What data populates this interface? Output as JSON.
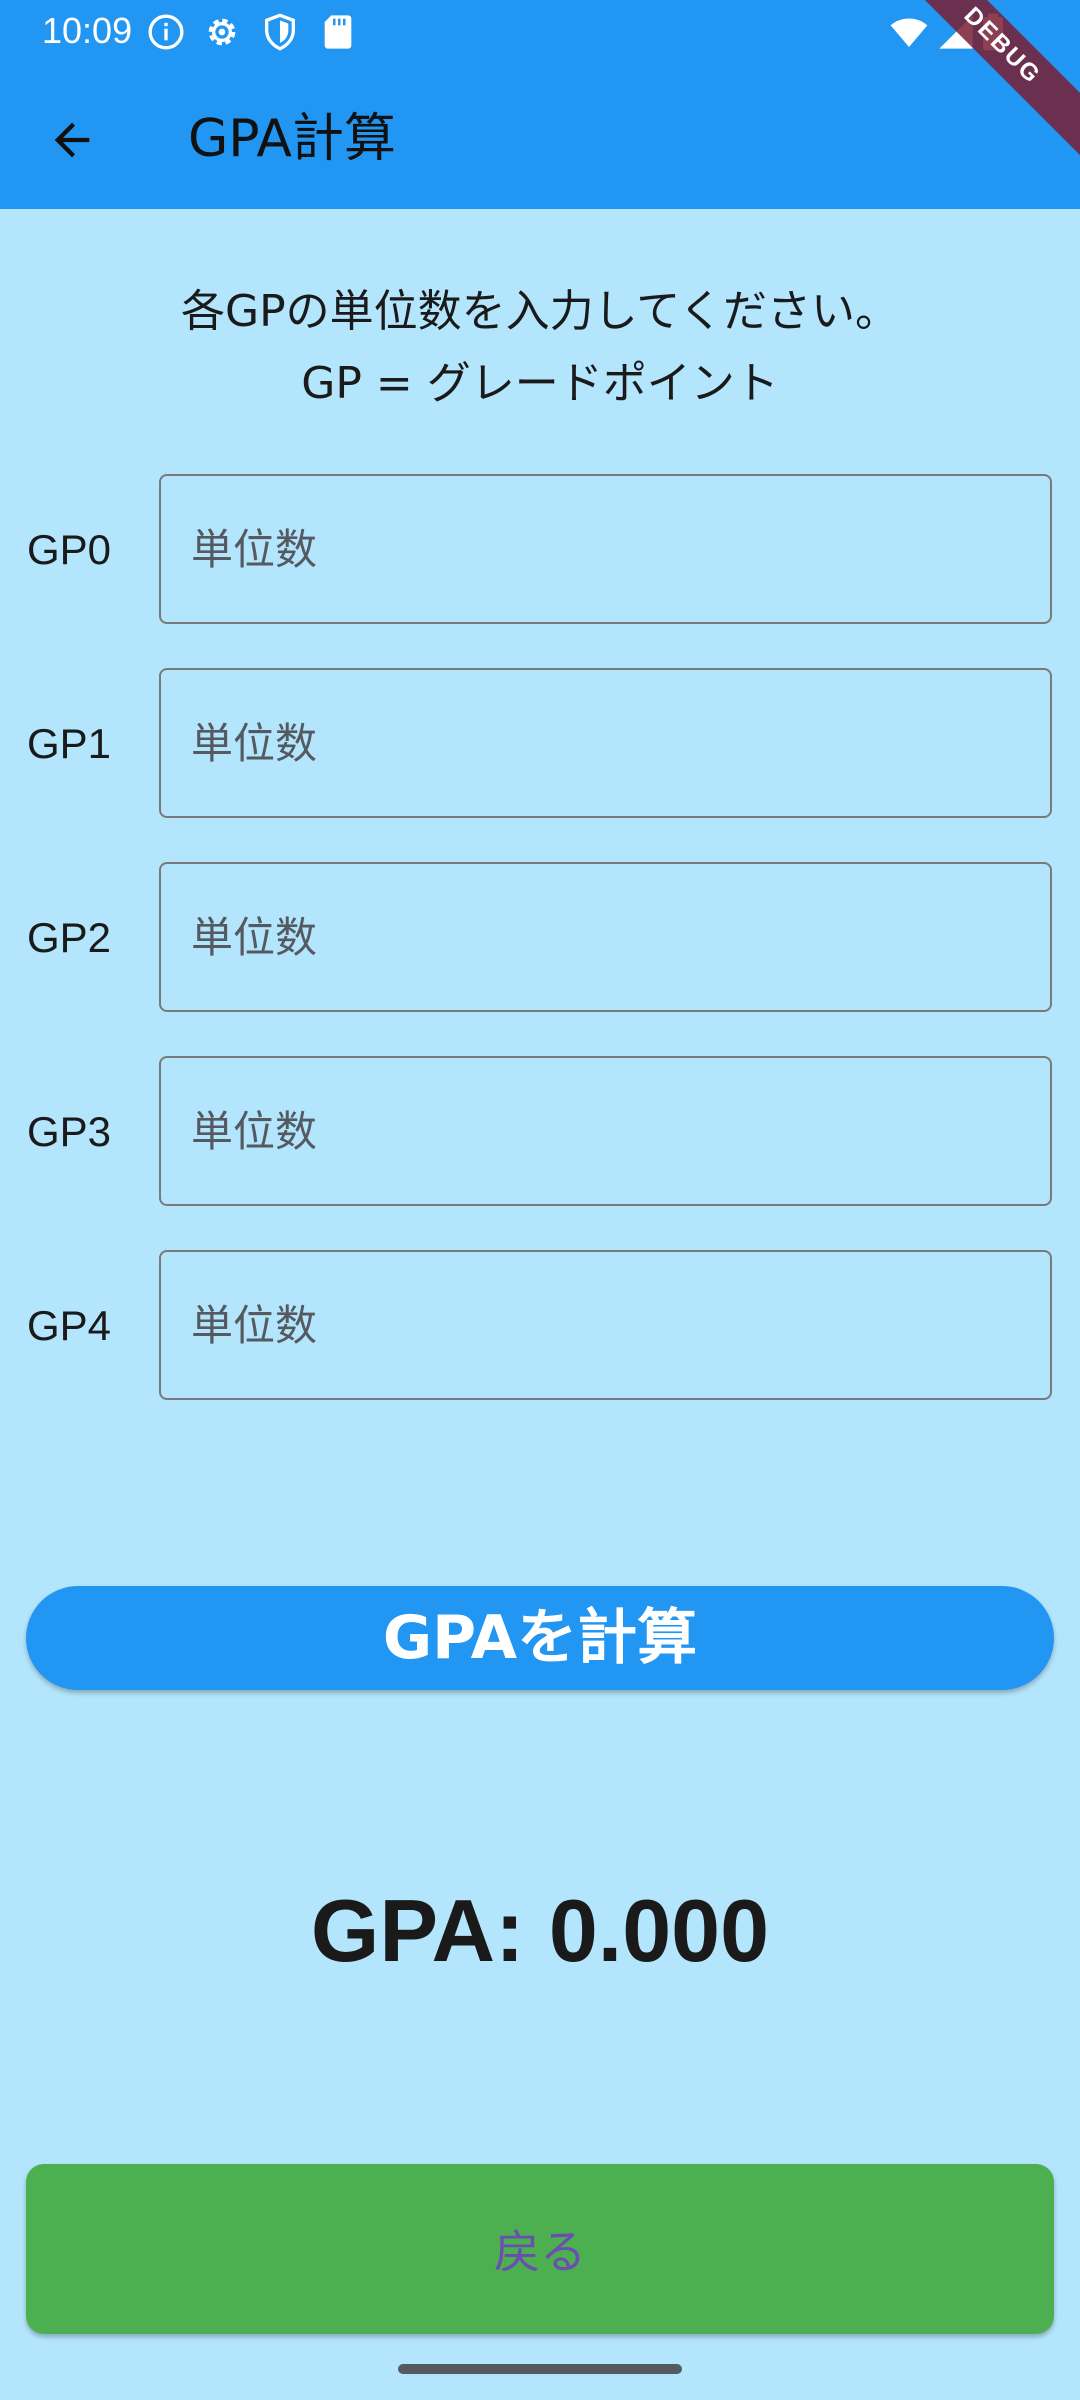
{
  "status_bar": {
    "time": "10:09",
    "icons": [
      "info-icon",
      "settings-icon",
      "shield-icon",
      "sd-card-icon",
      "wifi-icon",
      "signal-icon",
      "battery-icon"
    ]
  },
  "debug_banner": "DEBUG",
  "app_bar": {
    "title": "GPA計算",
    "background": "#2196f3"
  },
  "instructions": {
    "line1": "各GPの単位数を入力してください。",
    "line2": "GP = グレードポイント"
  },
  "gp_rows": [
    {
      "label": "GP0",
      "placeholder": "単位数",
      "value": ""
    },
    {
      "label": "GP1",
      "placeholder": "単位数",
      "value": ""
    },
    {
      "label": "GP2",
      "placeholder": "単位数",
      "value": ""
    },
    {
      "label": "GP3",
      "placeholder": "単位数",
      "value": ""
    },
    {
      "label": "GP4",
      "placeholder": "単位数",
      "value": ""
    }
  ],
  "calculate_button": {
    "label": "GPAを計算",
    "color": "#2196f3"
  },
  "result": {
    "text": "GPA: 0.000"
  },
  "back_button": {
    "label": "戻る",
    "color": "#4caf50"
  },
  "colors": {
    "page_background": "#b3e5fc"
  }
}
